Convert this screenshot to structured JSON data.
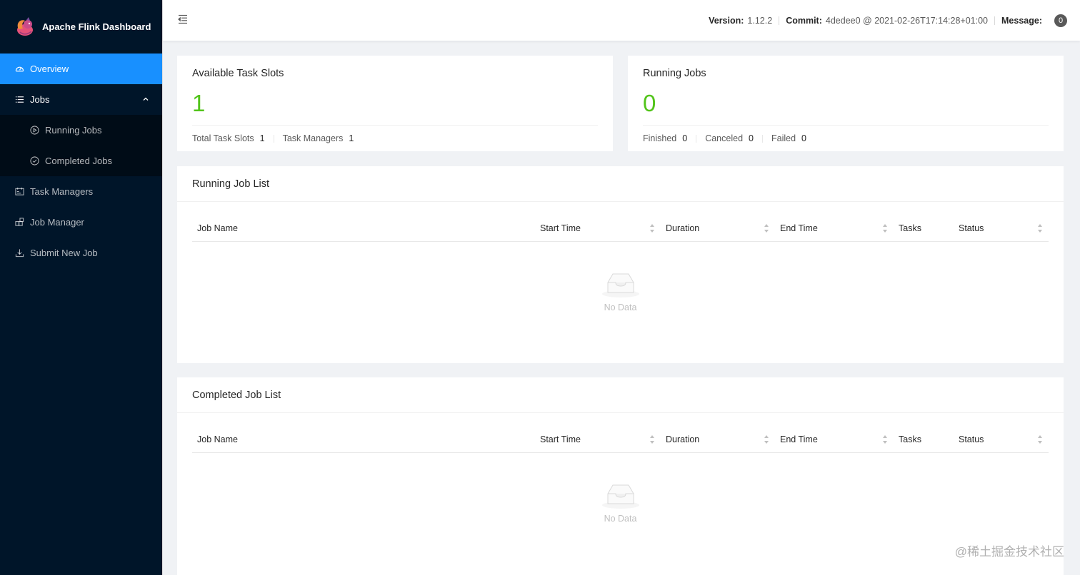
{
  "app": {
    "title": "Apache Flink Dashboard"
  },
  "sidebar": {
    "items": [
      {
        "label": "Overview",
        "icon": "dashboard-icon"
      },
      {
        "label": "Jobs",
        "icon": "list-icon"
      },
      {
        "label": "Running Jobs",
        "icon": "play-circle-icon"
      },
      {
        "label": "Completed Jobs",
        "icon": "check-circle-icon"
      },
      {
        "label": "Task Managers",
        "icon": "schedule-icon"
      },
      {
        "label": "Job Manager",
        "icon": "build-icon"
      },
      {
        "label": "Submit New Job",
        "icon": "upload-icon"
      }
    ]
  },
  "header": {
    "version_label": "Version:",
    "version": "1.12.2",
    "commit_label": "Commit:",
    "commit": "4dedee0 @ 2021-02-26T17:14:28+01:00",
    "message_label": "Message:",
    "message_count": "0"
  },
  "task_slots": {
    "title": "Available Task Slots",
    "value": "1",
    "total_label": "Total Task Slots",
    "total_value": "1",
    "tm_label": "Task Managers",
    "tm_value": "1"
  },
  "running_jobs": {
    "title": "Running Jobs",
    "value": "0",
    "finished_label": "Finished",
    "finished_value": "0",
    "canceled_label": "Canceled",
    "canceled_value": "0",
    "failed_label": "Failed",
    "failed_value": "0"
  },
  "running_list": {
    "title": "Running Job List",
    "columns": [
      "Job Name",
      "Start Time",
      "Duration",
      "End Time",
      "Tasks",
      "Status"
    ],
    "empty_text": "No Data"
  },
  "completed_list": {
    "title": "Completed Job List",
    "columns": [
      "Job Name",
      "Start Time",
      "Duration",
      "End Time",
      "Tasks",
      "Status"
    ],
    "empty_text": "No Data"
  },
  "colors": {
    "accent": "#1890ff",
    "sidebar": "#001529",
    "success": "#52c41a"
  },
  "watermark": "@稀土掘金技术社区"
}
